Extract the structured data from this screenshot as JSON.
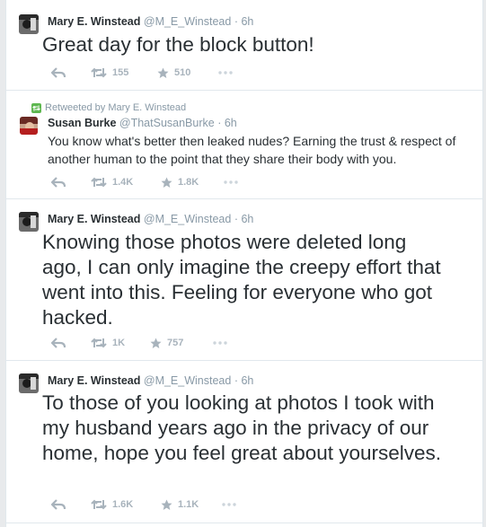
{
  "tweets": [
    {
      "name": "Mary E. Winstead",
      "handle": "@M_E_Winstead",
      "time": "· 6h",
      "text": "Great day for the block button!",
      "retweets": "155",
      "favorites": "510"
    },
    {
      "retweeted_by": "Retweeted by Mary E. Winstead",
      "name": "Susan Burke",
      "handle": "@ThatSusanBurke",
      "time": "· 6h",
      "text": "You know what's better then leaked nudes? Earning the trust & respect of another human to the point that they share their body with you.",
      "retweets": "1.4K",
      "favorites": "1.8K"
    },
    {
      "name": "Mary E. Winstead",
      "handle": "@M_E_Winstead",
      "time": "· 6h",
      "text": "Knowing those photos were deleted long ago, I can only imagine the creepy effort that went into this. Feeling for everyone who got hacked.",
      "retweets": "1K",
      "favorites": "757"
    },
    {
      "name": "Mary E. Winstead",
      "handle": "@M_E_Winstead",
      "time": "· 6h",
      "text": "To those of you looking at photos I took with my husband years ago in the privacy of our home, hope you feel great about yourselves.",
      "retweets": "1.6K",
      "favorites": "1.1K"
    }
  ],
  "icons": {
    "reply": "reply-icon",
    "retweet": "retweet-icon",
    "favorite": "star-icon",
    "more": "more-icon"
  },
  "colors": {
    "text": "#292f33",
    "muted": "#8899a6",
    "action": "#a8b3bc",
    "retweet_badge": "#5eb750"
  }
}
